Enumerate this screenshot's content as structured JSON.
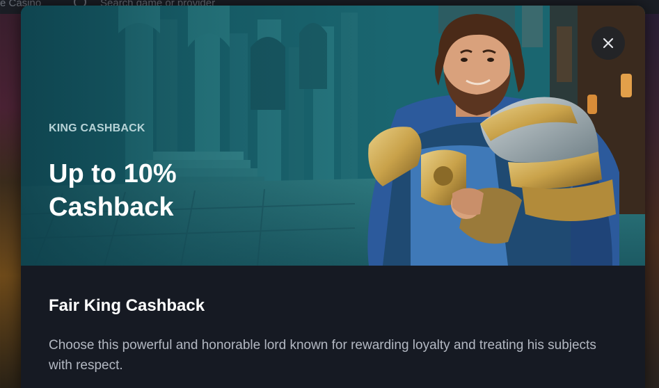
{
  "background": {
    "brand_text": "e Casino",
    "search_placeholder": "Search game or provider",
    "search_icon": "search-icon"
  },
  "modal": {
    "eyebrow": "KING CASHBACK",
    "title": "Up to 10% Cashback",
    "content_title": "Fair King Cashback",
    "description": "Choose this powerful and honorable lord known for rewarding loyalty and treating his subjects with respect.",
    "close_icon": "close-icon"
  },
  "colors": {
    "hero_teal": "#175f6c",
    "modal_bg": "#161a23",
    "armor_gold": "#c9a24a",
    "armor_blue": "#2c5a9c"
  }
}
